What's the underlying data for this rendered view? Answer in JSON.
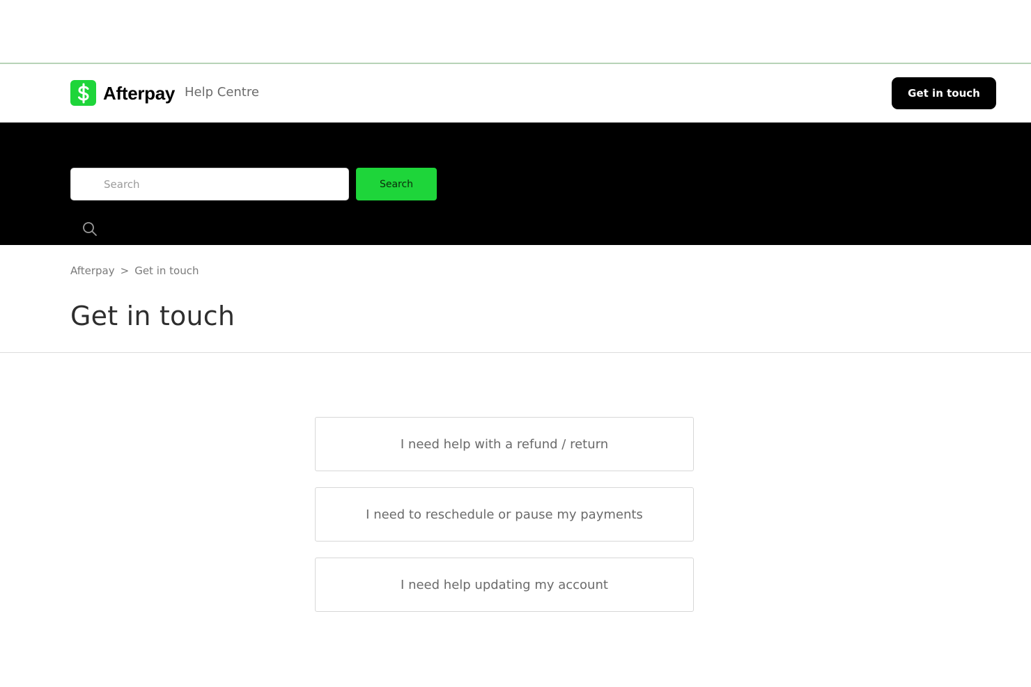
{
  "header": {
    "brand_name": "Afterpay",
    "subtitle": "Help Centre",
    "cta_label": "Get in touch",
    "brand_color": "#1ed53a",
    "logo_icon": "dollar-sign-icon"
  },
  "search": {
    "placeholder": "Search",
    "button_label": "Search",
    "icon": "search-icon"
  },
  "breadcrumb": {
    "items": [
      "Afterpay",
      "Get in touch"
    ],
    "separator": ">"
  },
  "page": {
    "title": "Get in touch"
  },
  "options": [
    {
      "label": "I need help with a refund / return"
    },
    {
      "label": "I need to reschedule or pause my payments"
    },
    {
      "label": "I need help updating my account"
    }
  ]
}
